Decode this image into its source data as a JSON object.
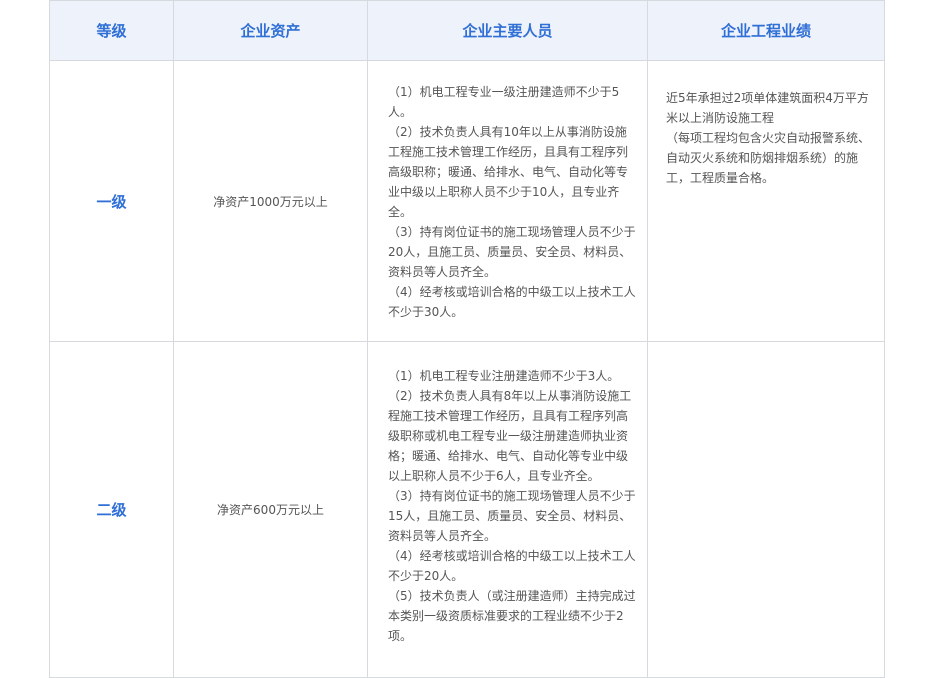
{
  "headers": [
    "等级",
    "企业资产",
    "企业主要人员",
    "企业工程业绩"
  ],
  "rows": [
    {
      "level": "一级",
      "asset": "净资产1000万元以上",
      "people": [
        "（1）机电工程专业一级注册建造师不少于5人。",
        "（2）技术负责人具有10年以上从事消防设施工程施工技术管理工作经历，且具有工程序列高级职称；暖通、给排水、电气、自动化等专业中级以上职称人员不少于10人，且专业齐全。",
        "（3）持有岗位证书的施工现场管理人员不少于20人，且施工员、质量员、安全员、材料员、资料员等人员齐全。",
        "（4）经考核或培训合格的中级工以上技术工人不少于30人。"
      ],
      "performance": [
        "近5年承担过2项单体建筑面积4万平方米以上消防设施工程",
        "（每项工程均包含火灾自动报警系统、自动灭火系统和防烟排烟系统）的施工，工程质量合格。"
      ]
    },
    {
      "level": "二级",
      "asset": "净资产600万元以上",
      "people": [
        "（1）机电工程专业注册建造师不少于3人。",
        "（2）技术负责人具有8年以上从事消防设施工程施工技术管理工作经历，且具有工程序列高级职称或机电工程专业一级注册建造师执业资格；暖通、给排水、电气、自动化等专业中级以上职称人员不少于6人，且专业齐全。",
        "（3）持有岗位证书的施工现场管理人员不少于15人，且施工员、质量员、安全员、材料员、资料员等人员齐全。",
        "（4）经考核或培训合格的中级工以上技术工人不少于20人。",
        "（5）技术负责人（或注册建造师）主持完成过本类别一级资质标准要求的工程业绩不少于2项。"
      ],
      "performance": []
    }
  ]
}
